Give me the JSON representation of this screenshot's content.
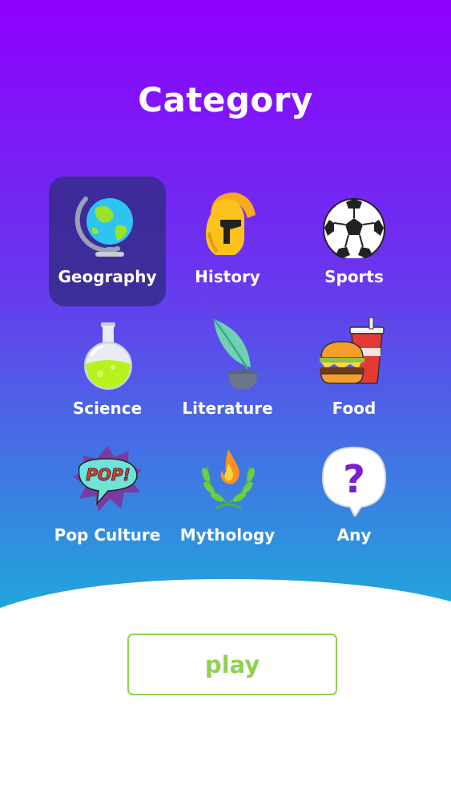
{
  "screen": {
    "title": "Category",
    "colors": {
      "gradient_top": "#8f00ff",
      "gradient_bottom": "#21a6db",
      "selected_tile": "#302c82",
      "play_accent": "#8fd14f"
    }
  },
  "categories": [
    {
      "label": "Geography",
      "icon": "globe-icon",
      "selected": true
    },
    {
      "label": "History",
      "icon": "spartan-helmet-icon",
      "selected": false
    },
    {
      "label": "Sports",
      "icon": "soccer-ball-icon",
      "selected": false
    },
    {
      "label": "Science",
      "icon": "flask-icon",
      "selected": false
    },
    {
      "label": "Literature",
      "icon": "quill-inkwell-icon",
      "selected": false
    },
    {
      "label": "Food",
      "icon": "burger-drink-icon",
      "selected": false
    },
    {
      "label": "Pop Culture",
      "icon": "pop-bubble-icon",
      "selected": false
    },
    {
      "label": "Mythology",
      "icon": "laurel-flame-icon",
      "selected": false
    },
    {
      "label": "Any",
      "icon": "question-bubble-icon",
      "selected": false
    }
  ],
  "icon_text": {
    "pop": "POP!",
    "question": "?"
  },
  "play_button": {
    "label": "play"
  }
}
